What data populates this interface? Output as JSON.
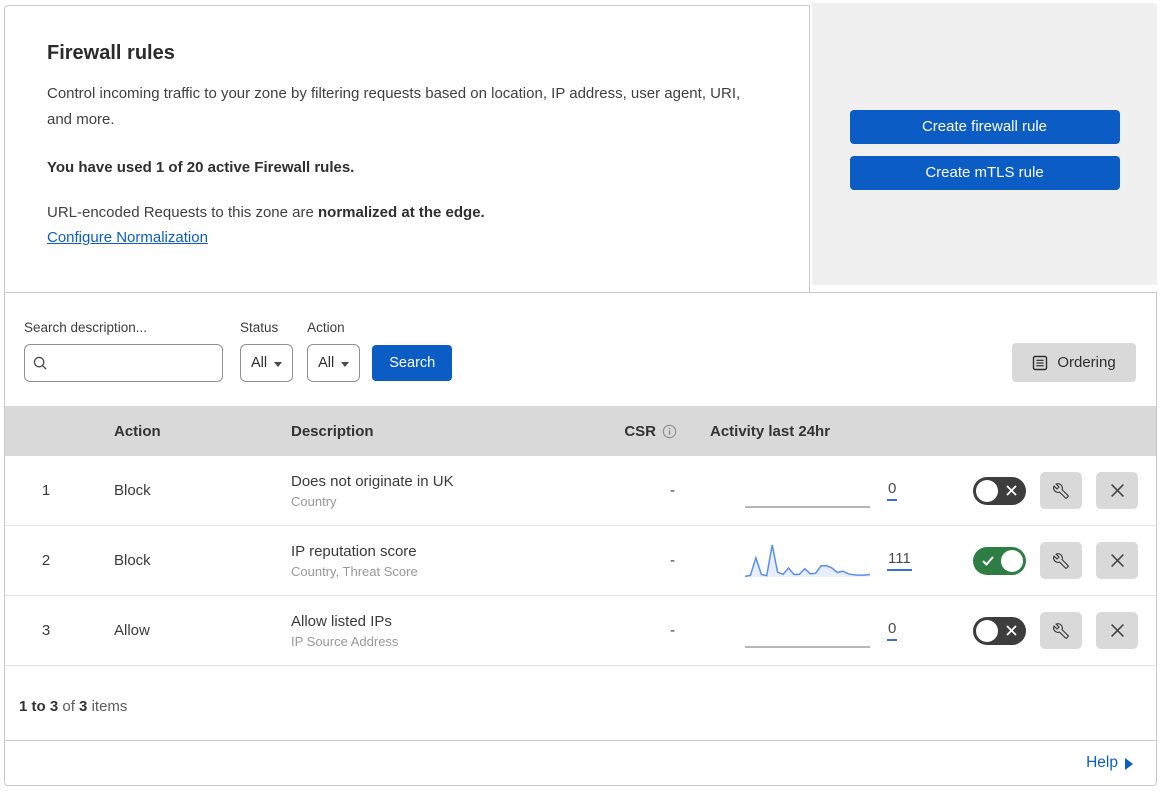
{
  "intro": {
    "title": "Firewall rules",
    "description": "Control incoming traffic to your zone by filtering requests based on location, IP address, user agent, URI, and more.",
    "usage": "You have used 1 of 20 active Firewall rules.",
    "normalization_text": "URL-encoded Requests to this zone are ",
    "normalization_bold": "normalized at the edge.",
    "normalization_link": "Configure Normalization"
  },
  "actions": {
    "create_firewall": "Create firewall rule",
    "create_mtls": "Create mTLS rule"
  },
  "filters": {
    "search_label": "Search description...",
    "search_value": "",
    "status_label": "Status",
    "status_value": "All",
    "action_label": "Action",
    "action_value": "All",
    "search_button": "Search",
    "ordering_button": "Ordering"
  },
  "table": {
    "headers": {
      "action": "Action",
      "description": "Description",
      "csr": "CSR",
      "activity": "Activity last 24hr"
    },
    "rows": [
      {
        "index": "1",
        "action": "Block",
        "description": "Does not originate in UK",
        "fields": "Country",
        "csr": "-",
        "activity_count": "0",
        "enabled": false,
        "sparkline": {
          "color": "#9e9e9e",
          "values": [
            0,
            0,
            0,
            0,
            0,
            0,
            0,
            0,
            0,
            0,
            0,
            0
          ]
        }
      },
      {
        "index": "2",
        "action": "Block",
        "description": "IP reputation score",
        "fields": "Country, Threat Score",
        "csr": "-",
        "activity_count": "111",
        "enabled": true,
        "sparkline": {
          "color": "#5b8def",
          "values": [
            2,
            5,
            60,
            8,
            4,
            100,
            15,
            8,
            28,
            8,
            8,
            26,
            10,
            12,
            35,
            35,
            28,
            14,
            18,
            10,
            7,
            6,
            6,
            8
          ]
        }
      },
      {
        "index": "3",
        "action": "Allow",
        "description": "Allow listed IPs",
        "fields": "IP Source Address",
        "csr": "-",
        "activity_count": "0",
        "enabled": false,
        "sparkline": {
          "color": "#9e9e9e",
          "values": [
            0,
            0,
            0,
            0,
            0,
            0,
            0,
            0,
            0,
            0,
            0,
            0
          ]
        }
      }
    ]
  },
  "footer": {
    "range": "1 to 3",
    "of": "of",
    "total": "3",
    "items": "items"
  },
  "help": {
    "label": "Help"
  },
  "colors": {
    "primary_blue": "#0b5cc5",
    "toggle_on_green": "#2e7d44",
    "toggle_off_gray": "#3d3d3d",
    "table_header_gray": "#d9d9d9",
    "panel_gray": "#f1f0f0",
    "sparkline_blue": "#5b8def"
  }
}
